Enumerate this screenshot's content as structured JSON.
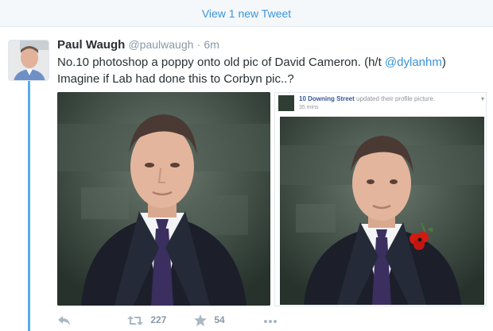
{
  "banner": {
    "label": "View 1 new Tweet"
  },
  "tweet": {
    "name": "Paul Waugh",
    "handle": "@paulwaugh",
    "dot": "·",
    "time": "6m",
    "line1_pre": "No.10 photoshop a poppy onto old pic of David Cameron. (h/t ",
    "mention": "@dylanhm",
    "line1_post": ")",
    "line2": "Imagine if Lab had done this to Corbyn pic..?"
  },
  "embed": {
    "page_name": "10 Downing Street",
    "action": "updated their profile picture.",
    "time": "35 mins"
  },
  "actions": {
    "retweets": "227",
    "likes": "54"
  },
  "colors": {
    "accent": "#55acee",
    "link": "#3b94d9",
    "muted": "#8899a6",
    "poppy": "#d11a12"
  },
  "icons": [
    "reply-icon",
    "retweet-icon",
    "like-icon",
    "more-icon"
  ]
}
